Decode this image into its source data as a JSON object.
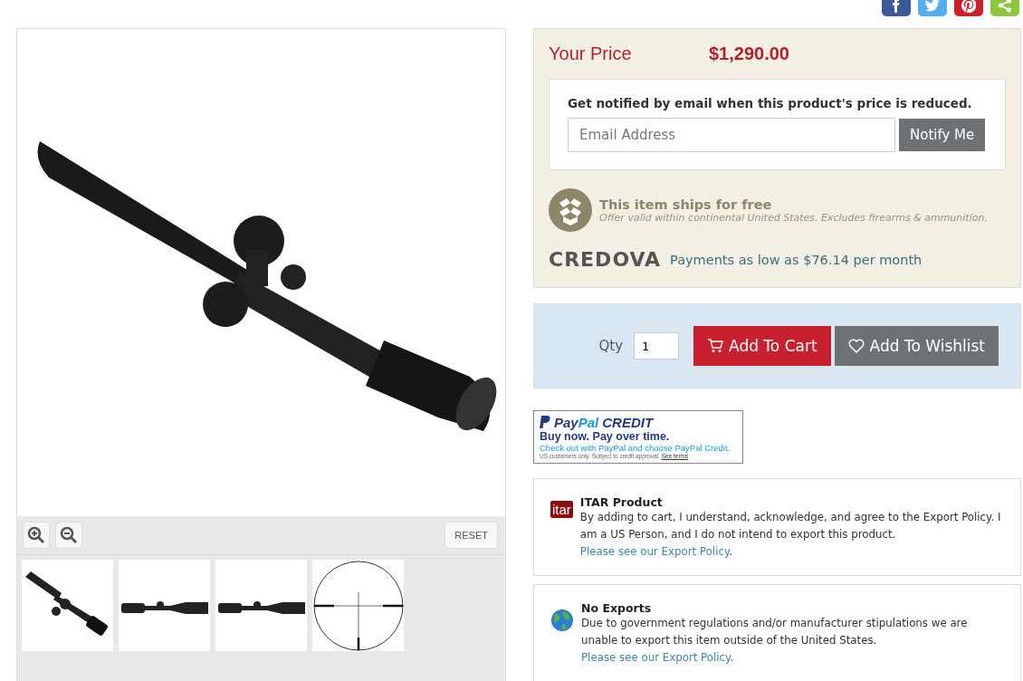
{
  "share_buttons": [
    {
      "kind": "facebook"
    },
    {
      "kind": "twitter"
    },
    {
      "kind": "pinterest"
    },
    {
      "kind": "share"
    }
  ],
  "gallery": {
    "reset_button": "RESET",
    "thumbnails": [
      {
        "kind": "angled"
      },
      {
        "kind": "side"
      },
      {
        "kind": "side"
      },
      {
        "kind": "reticle"
      }
    ]
  },
  "price_panel": {
    "label": "Your Price",
    "price": "$1,290.00",
    "notify": {
      "heading": "Get notified by email when this product's price is reduced.",
      "placeholder": "Email Address",
      "button": "Notify Me"
    },
    "shipping": {
      "title": "This item ships for free",
      "note": "Offer valid within continental United States. Excludes firearms & ammunition."
    },
    "financing": {
      "logo": "CREDOVA",
      "text": "Payments as low as $76.14 per month"
    }
  },
  "cart": {
    "qty_label": "Qty",
    "qty_value": "1",
    "add_button": "Add To Cart",
    "wishlist_button": "Add To Wishlist"
  },
  "paypal_banner": {
    "brand_dark": "Pay",
    "brand_light": "Pal",
    "brand_suffix": "CREDIT",
    "headline": "Buy now. Pay over time.",
    "subline": "Check out with PayPal and choose PayPal Credit.",
    "fine_print": "US customers only. Subject to credit approval.",
    "link": "See terms"
  },
  "notices": [
    {
      "kind": "itar",
      "badge": "itar",
      "title": "ITAR Product",
      "text": "By adding to cart, I understand, acknowledge, and agree to the Export Policy. I am a US Person, and I do not intend to export this product.",
      "link": "Please see our Export Policy",
      "after": "."
    },
    {
      "kind": "globe",
      "title": "No Exports",
      "text": "Due to government regulations and/or manufacturer stipulations we are unable to export this item outside of the United States.",
      "link": "Please see our Export Policy",
      "after": "."
    }
  ]
}
